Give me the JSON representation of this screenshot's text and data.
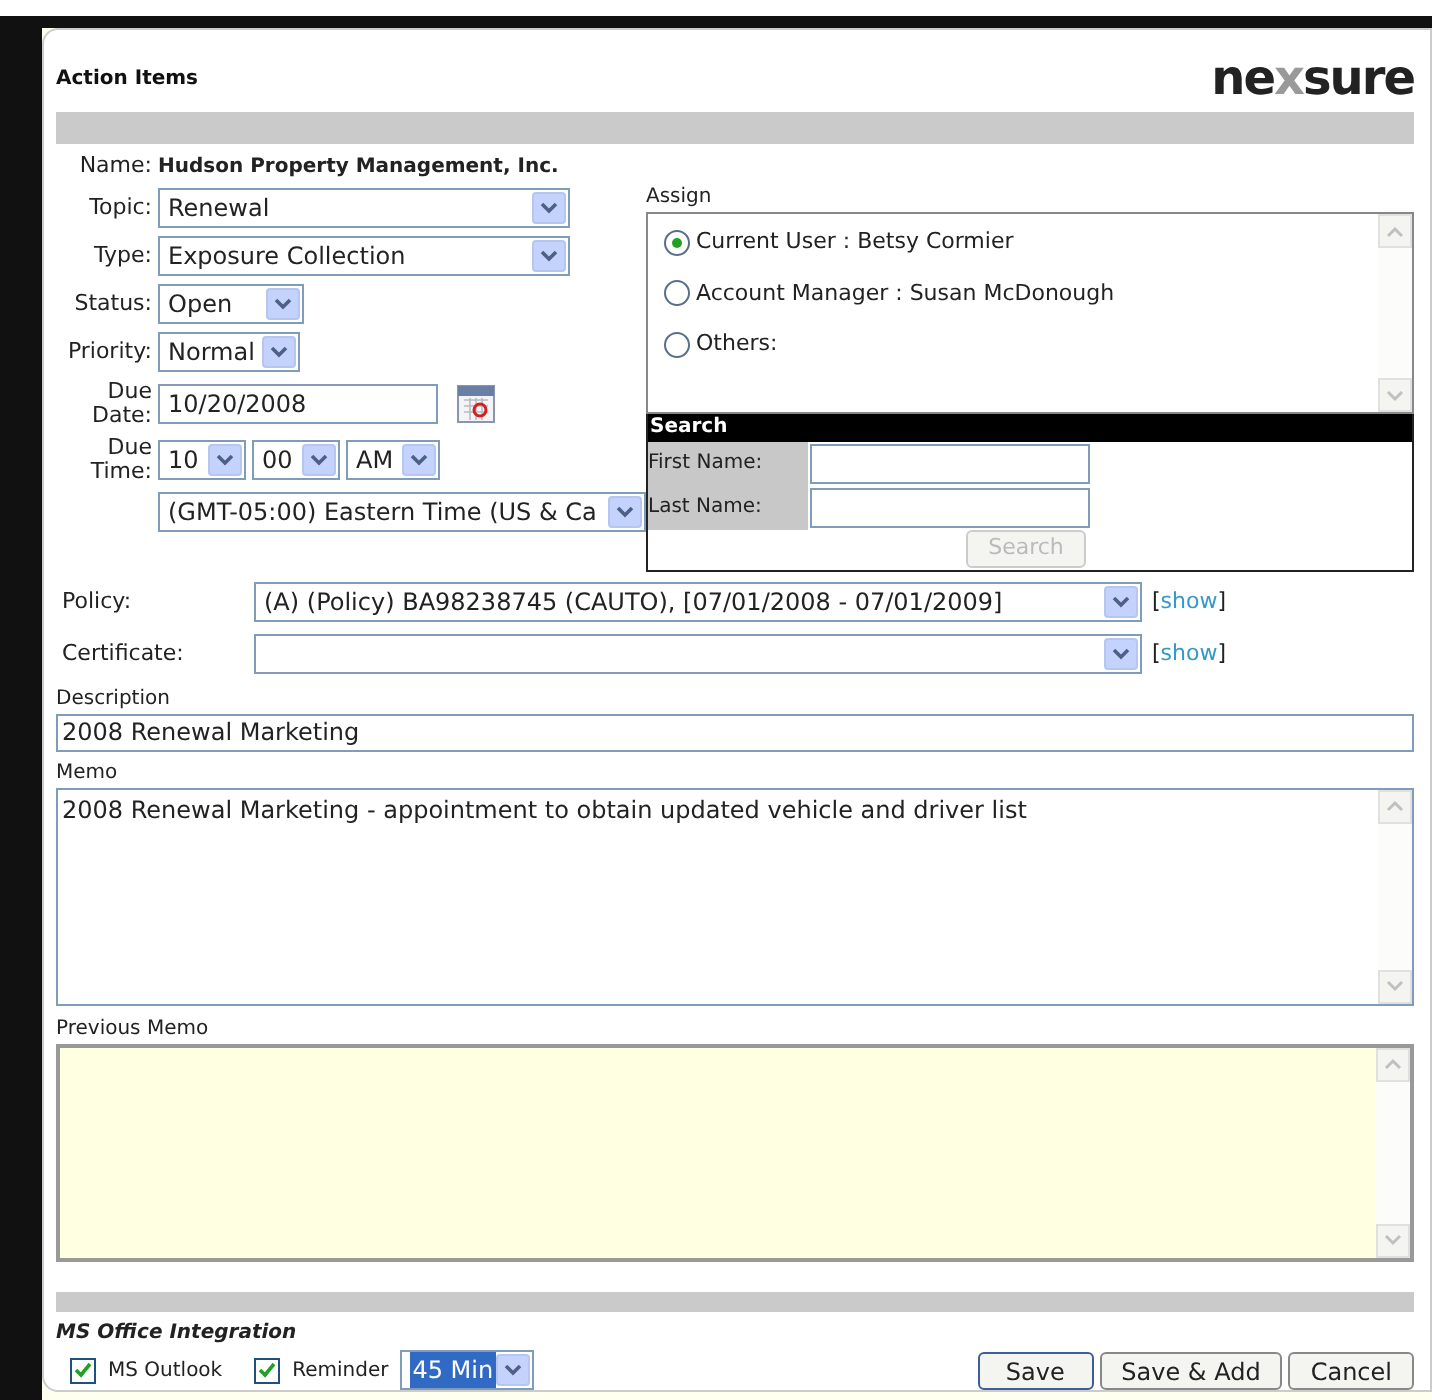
{
  "header": {
    "title": "Action Items",
    "logo": [
      "ne",
      "x",
      "sure"
    ]
  },
  "name": {
    "label": "Name:",
    "value": "Hudson Property Management, Inc."
  },
  "fields": [
    {
      "label": "Topic:",
      "value": "Renewal"
    },
    {
      "label": "Type:",
      "value": "Exposure Collection"
    },
    {
      "label": "Status:",
      "value": "Open"
    },
    {
      "label": "Priority:",
      "value": "Normal"
    }
  ],
  "due_date": {
    "label": [
      "Due",
      "Date:"
    ],
    "value": "10/20/2008"
  },
  "due_time": {
    "label": [
      "Due",
      "Time:"
    ],
    "hour": "10",
    "minute": "00",
    "ampm": "AM",
    "timezone": "(GMT-05:00) Eastern Time (US & Ca"
  },
  "assign": {
    "label": "Assign",
    "options": [
      {
        "label": "Current User : Betsy Cormier",
        "selected": true
      },
      {
        "label": "Account Manager : Susan McDonough",
        "selected": false
      },
      {
        "label": "Others:",
        "selected": false
      }
    ]
  },
  "search": {
    "title": "Search",
    "first_name_label": "First Name:",
    "last_name_label": "Last Name:",
    "button": "Search"
  },
  "links": [
    {
      "label": "Policy:",
      "value": "(A) (Policy) BA98238745 (CAUTO), [07/01/2008 - 07/01/2009]",
      "link": "show",
      "brackets": [
        "[",
        "]"
      ]
    },
    {
      "label": "Certificate:",
      "link": "show",
      "brackets": [
        "[",
        "]"
      ]
    }
  ],
  "description": {
    "label": "Description",
    "value": "2008 Renewal Marketing"
  },
  "memo": {
    "label": "Memo",
    "value": "2008 Renewal Marketing - appointment to obtain updated vehicle and driver list"
  },
  "previous_memo": {
    "label": "Previous Memo"
  },
  "office": {
    "title": "MS Office Integration",
    "outlook": {
      "label": "MS Outlook",
      "checked": true
    },
    "reminder": {
      "label": "Reminder",
      "checked": true
    },
    "reminder_time": "45 Min"
  },
  "buttons": [
    "Save",
    "Save & Add",
    "Cancel"
  ]
}
